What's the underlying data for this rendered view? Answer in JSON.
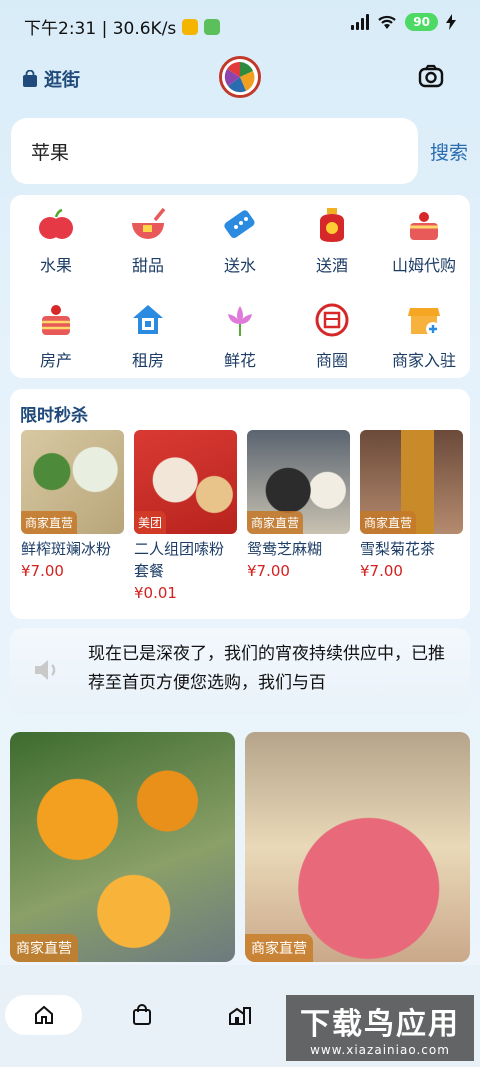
{
  "status_bar": {
    "time_speed": "下午2:31 | 30.6K/s",
    "battery": "90"
  },
  "header": {
    "brand": "逛街"
  },
  "search": {
    "value": "苹果",
    "button": "搜索"
  },
  "categories": [
    {
      "label": "水果",
      "icon": "apple-icon"
    },
    {
      "label": "甜品",
      "icon": "dessert-bowl-icon"
    },
    {
      "label": "送水",
      "icon": "water-ticket-icon"
    },
    {
      "label": "送酒",
      "icon": "wine-jar-icon"
    },
    {
      "label": "山姆代购",
      "icon": "cake-icon"
    },
    {
      "label": "房产",
      "icon": "house-cake-icon"
    },
    {
      "label": "租房",
      "icon": "rent-house-icon"
    },
    {
      "label": "鲜花",
      "icon": "lily-flower-icon"
    },
    {
      "label": "商圈",
      "icon": "shop-circle-icon"
    },
    {
      "label": "商家入驻",
      "icon": "store-join-icon"
    }
  ],
  "flash_sale": {
    "title": "限时秒杀",
    "items": [
      {
        "tag": "商家直营",
        "name": "鲜榨斑斓冰粉",
        "price": "¥7.00"
      },
      {
        "tag": "美团",
        "name": "二人组团嗦粉套餐",
        "price": "¥0.01"
      },
      {
        "tag": "商家直营",
        "name": "鸳鸯芝麻糊",
        "price": "¥7.00"
      },
      {
        "tag": "商家直营",
        "name": "雪梨菊花茶",
        "price": "¥7.00"
      }
    ]
  },
  "notice": {
    "text": "现在已是深夜了，我们的宵夜持续供应中，已推荐至首页方便您选购，我们与百"
  },
  "feed": [
    {
      "tag": "商家直营"
    },
    {
      "tag": "商家直营"
    }
  ],
  "colors": {
    "accent": "#2b6cb0",
    "price": "#d32020",
    "tag": "#c47828"
  },
  "watermark": {
    "line1": "下载鸟应用",
    "line2": "www.xiazainiao.com"
  }
}
